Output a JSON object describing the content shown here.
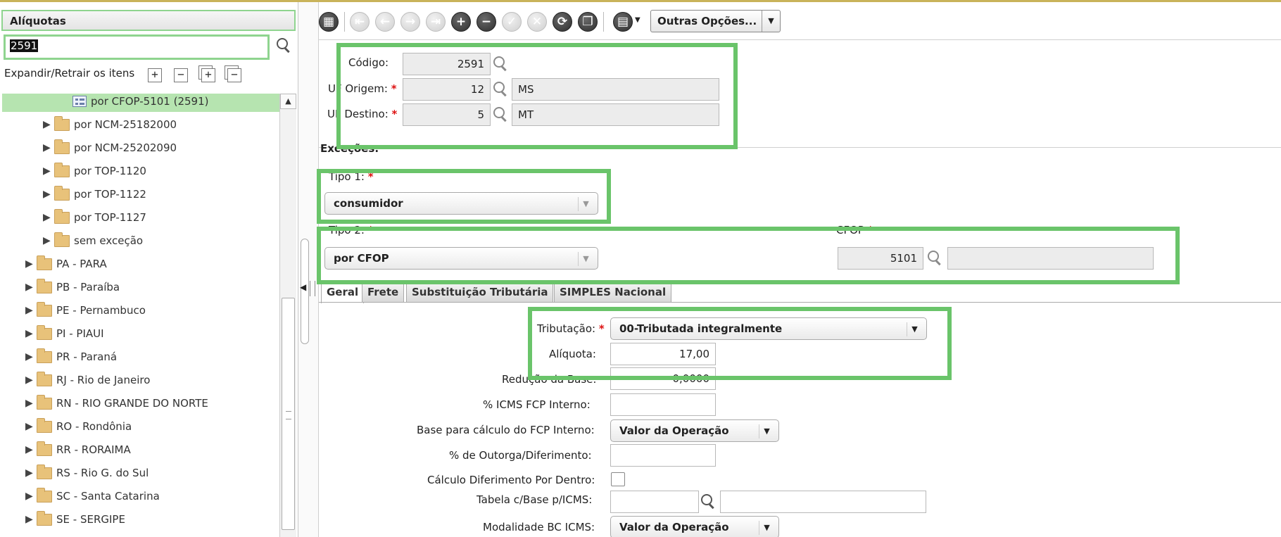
{
  "left_panel": {
    "title": "Alíquotas",
    "search_value": "2591",
    "expand_label": "Expandir/Retrair os itens",
    "tree": [
      {
        "label": "por CFOP-5101 (2591)",
        "selected": true,
        "kind": "node"
      },
      {
        "label": "por NCM-25182000",
        "kind": "folder"
      },
      {
        "label": "por NCM-25202090",
        "kind": "folder"
      },
      {
        "label": "por TOP-1120",
        "kind": "folder"
      },
      {
        "label": "por TOP-1122",
        "kind": "folder"
      },
      {
        "label": "por TOP-1127",
        "kind": "folder"
      },
      {
        "label": "sem exceção",
        "kind": "folder"
      },
      {
        "label": "PA - PARA",
        "kind": "folder"
      },
      {
        "label": "PB - Paraíba",
        "kind": "folder"
      },
      {
        "label": "PE - Pernambuco",
        "kind": "folder"
      },
      {
        "label": "PI - PIAUI",
        "kind": "folder"
      },
      {
        "label": "PR - Paraná",
        "kind": "folder"
      },
      {
        "label": "RJ - Rio de Janeiro",
        "kind": "folder"
      },
      {
        "label": "RN - RIO GRANDE DO NORTE",
        "kind": "folder"
      },
      {
        "label": "RO - Rondônia",
        "kind": "folder"
      },
      {
        "label": "RR - RORAIMA",
        "kind": "folder"
      },
      {
        "label": "RS - Rio G. do Sul",
        "kind": "folder"
      },
      {
        "label": "SC - Santa Catarina",
        "kind": "folder"
      },
      {
        "label": "SE - SERGIPE",
        "kind": "folder"
      }
    ]
  },
  "toolbar": {
    "more_options_label": "Outras Opções..."
  },
  "form": {
    "codigo_label": "Código:",
    "codigo_value": "2591",
    "uf_origem_label": "UF Origem:",
    "uf_origem_code": "12",
    "uf_origem_name": "MS",
    "uf_destino_label": "UF Destino:",
    "uf_destino_code": "5",
    "uf_destino_name": "MT",
    "excecoes_title": "Exceções:",
    "tipo1_label": "Tipo 1:",
    "tipo1_value": "consumidor",
    "tipo2_label": "Tipo 2:",
    "tipo2_value": "por CFOP",
    "cfop_label": "CFOP",
    "cfop_value": "5101",
    "cfop_desc": ""
  },
  "tabs": [
    "Geral",
    "Frete",
    "Substituição Tributária",
    "SIMPLES Nacional"
  ],
  "geral": {
    "tributacao_label": "Tributação:",
    "tributacao_value": "00-Tributada integralmente",
    "aliquota_label": "Alíquota:",
    "aliquota_value": "17,00",
    "reducao_label": "Redução da Base:",
    "reducao_value": "0,0000",
    "fcp_interno_label": "% ICMS FCP Interno:",
    "fcp_interno_value": "",
    "base_fcp_label": "Base para cálculo do FCP Interno:",
    "base_fcp_value": "Valor da Operação",
    "outorga_label": "% de Outorga/Diferimento:",
    "outorga_value": "",
    "calc_dif_label": "Cálculo Diferimento Por Dentro:",
    "tabela_label": "Tabela c/Base p/ICMS:",
    "tabela_code": "",
    "tabela_desc": "",
    "modalidade_label": "Modalidade BC ICMS:",
    "modalidade_value": "Valor da Operação"
  },
  "colors": {
    "highlight": "#6ac46a",
    "selected_row": "#b6e4b0",
    "required": "#dd1111"
  }
}
